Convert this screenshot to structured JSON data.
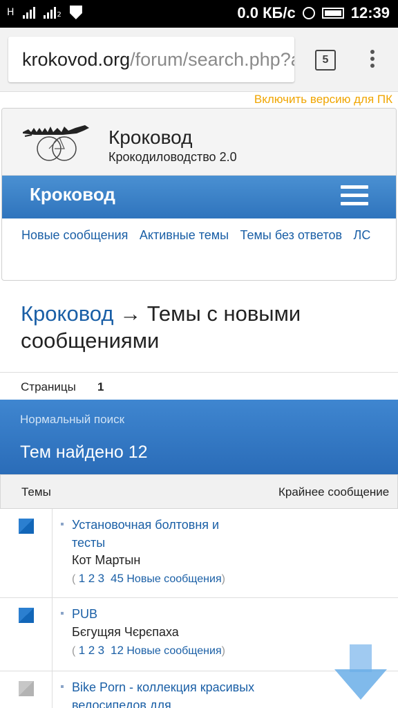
{
  "status_bar": {
    "network_left": "H",
    "sim2_label": "2",
    "speed": "0.0 КБ/с",
    "time": "12:39"
  },
  "browser": {
    "url_host": "krokovod.org",
    "url_path": "/forum/search.php?ac",
    "tab_count": "5"
  },
  "pc_version_link": "Включить версию для ПК",
  "site": {
    "title": "Кроковод",
    "description": "Крокодиловодство 2.0"
  },
  "navbar": {
    "brand": "Кроковод",
    "links": [
      "Новые сообщения",
      "Активные темы",
      "Темы без ответов",
      "ЛС"
    ]
  },
  "heading": {
    "crumb": "Кроковод",
    "arrow": "→",
    "title": "Темы с новыми сообщениями"
  },
  "pagination": {
    "label": "Страницы",
    "current": "1"
  },
  "search": {
    "mode": "Нормальный поиск",
    "found": "Тем найдено 12"
  },
  "table": {
    "col_topics": "Темы",
    "col_last_post": "Крайнее сообщение"
  },
  "topics": [
    {
      "title": "Установочная болтовня и тесты",
      "author": "Кот Мартын",
      "pages": [
        "1",
        "2",
        "3",
        "45"
      ],
      "new_posts": "Новые сообщения"
    },
    {
      "title": "PUB",
      "author": "Бєгущяя Чєрєпаха",
      "pages": [
        "1",
        "2",
        "3",
        "12"
      ],
      "new_posts": "Новые сообщения"
    },
    {
      "title": "Bike Porn - коллекция красивых велосипедов для",
      "author": "",
      "pages": [],
      "new_posts": ""
    }
  ],
  "colors": {
    "link": "#1a5fa6",
    "navbar": "#3a83cc",
    "pc_link": "#f0a500",
    "topic_icon_new": "#2b7fd0",
    "topic_icon_read": "#c0c0c0"
  },
  "icons": [
    "wifi-icon",
    "signal-icon",
    "shield-icon",
    "alarm-icon",
    "battery-icon",
    "tabs-icon",
    "menu-icon",
    "hamburger-icon",
    "topic-icon",
    "scroll-down-icon"
  ]
}
